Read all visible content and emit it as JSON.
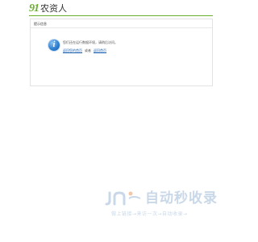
{
  "header": {
    "logo_mark": "91",
    "site_name": "农资人",
    "accent_color": "#6ab02e"
  },
  "panel": {
    "title": "提示信息",
    "icon": "info-icon",
    "message": "您们还在运行数据环境，请稍后访问。",
    "link_primary": "返回您的首页",
    "link_separator": "或者",
    "link_secondary": "返回首页"
  },
  "watermark": {
    "title": "自动秒收录",
    "subtitle": "做上链接→来访一次→自动收录→"
  }
}
